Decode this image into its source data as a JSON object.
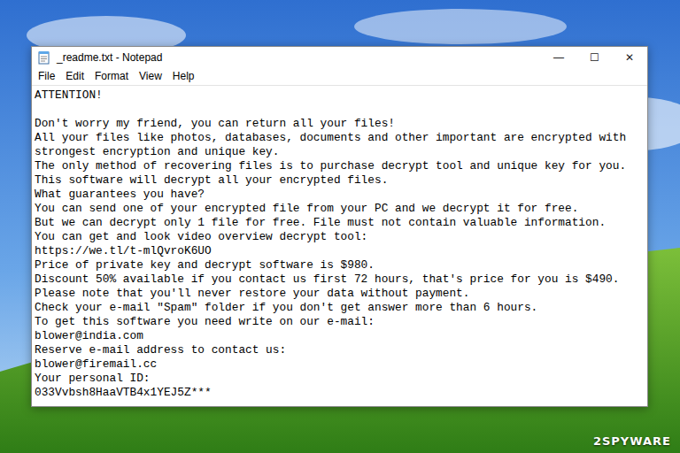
{
  "window": {
    "title": "_readme.txt - Notepad",
    "controls": [
      "—",
      "☐",
      "✕"
    ]
  },
  "menu": [
    "File",
    "Edit",
    "Format",
    "View",
    "Help"
  ],
  "document": {
    "lines": [
      "ATTENTION!",
      "",
      "Don't worry my friend, you can return all your files!",
      "All your files like photos, databases, documents and other important are encrypted with",
      "strongest encryption and unique key.",
      "The only method of recovering files is to purchase decrypt tool and unique key for you.",
      "This software will decrypt all your encrypted files.",
      "What guarantees you have?",
      "You can send one of your encrypted file from your PC and we decrypt it for free.",
      "But we can decrypt only 1 file for free. File must not contain valuable information.",
      "You can get and look video overview decrypt tool:",
      "https://we.tl/t-mlQvroK6UO",
      "Price of private key and decrypt software is $980.",
      "Discount 50% available if you contact us first 72 hours, that's price for you is $490.",
      "Please note that you'll never restore your data without payment.",
      "Check your e-mail \"Spam\" folder if you don't get answer more than 6 hours.",
      "To get this software you need write on our e-mail:",
      "blower@india.com",
      "Reserve e-mail address to contact us:",
      "blower@firemail.cc",
      "Your personal ID:",
      "033Vvbsh8HaaVTB4x1YEJ5Z***"
    ]
  },
  "watermark": "2SPYWARE"
}
